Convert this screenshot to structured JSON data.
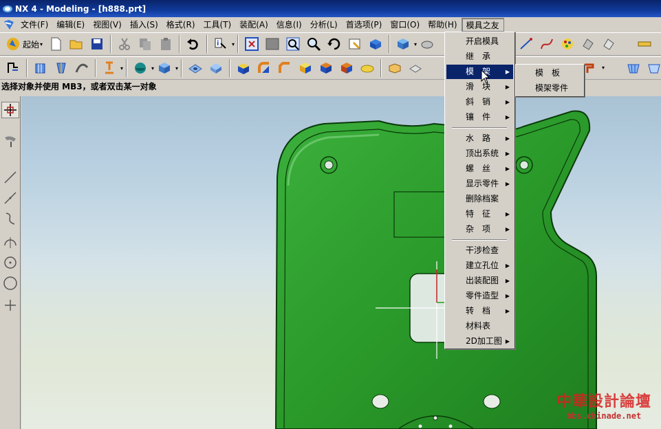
{
  "window": {
    "title": "NX 4 - Modeling - [h888.prt]"
  },
  "menubar": {
    "items": [
      "文件(F)",
      "编辑(E)",
      "视图(V)",
      "插入(S)",
      "格式(R)",
      "工具(T)",
      "装配(A)",
      "信息(I)",
      "分析(L)",
      "首选项(P)",
      "窗口(O)",
      "帮助(H)",
      "模具之友"
    ]
  },
  "toolbar": {
    "start_label": "起始"
  },
  "status": {
    "prompt": "选择对象并使用 MB3，或者双击某一对象"
  },
  "dropdown": {
    "items": [
      {
        "label": "开启模具",
        "submenu": false
      },
      {
        "label": "继　承",
        "submenu": false
      },
      {
        "label": "模　架",
        "submenu": true,
        "highlighted": true
      },
      {
        "label": "滑　块",
        "submenu": true
      },
      {
        "label": "斜　销",
        "submenu": true
      },
      {
        "label": "镶　件",
        "submenu": true
      },
      {
        "label": "水　路",
        "submenu": true
      },
      {
        "label": "顶出系统",
        "submenu": true
      },
      {
        "label": "螺　丝",
        "submenu": true
      },
      {
        "label": "显示零件",
        "submenu": true
      },
      {
        "label": "删除档案",
        "submenu": false
      },
      {
        "label": "特　征",
        "submenu": true
      },
      {
        "label": "杂　项",
        "submenu": true
      },
      {
        "label": "干涉检查",
        "submenu": false
      },
      {
        "label": "建立孔位",
        "submenu": true
      },
      {
        "label": "出装配图",
        "submenu": true
      },
      {
        "label": "零件造型",
        "submenu": true
      },
      {
        "label": "转　档",
        "submenu": true
      },
      {
        "label": "材料表",
        "submenu": false
      },
      {
        "label": "2D加工图",
        "submenu": true
      }
    ]
  },
  "submenu": {
    "items": [
      "模　板",
      "模架零件"
    ]
  },
  "watermark": {
    "line1": "中華設計論壇",
    "line2": "bbs.chinade.net"
  },
  "colors": {
    "highlight": "#0a246a",
    "part_green": "#2a9a2a",
    "titlebar": "#0a246a"
  }
}
